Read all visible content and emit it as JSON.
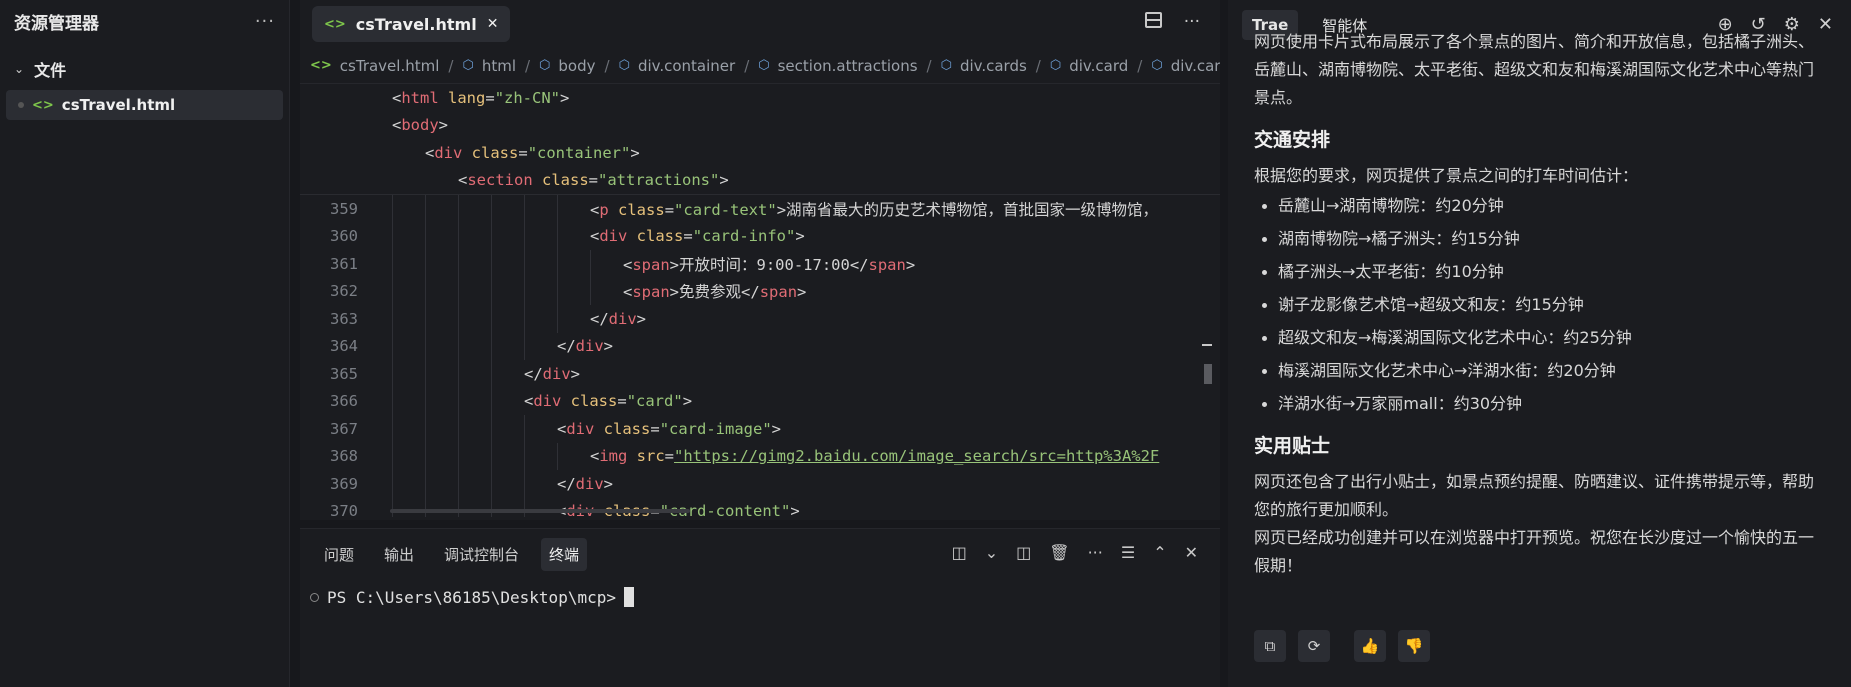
{
  "explorer": {
    "title": "资源管理器",
    "more_icon": "more-icon",
    "folder": "文件",
    "file": "csTravel.html"
  },
  "editor": {
    "tab_name": "csTravel.html",
    "breadcrumb": [
      "csTravel.html",
      "html",
      "body",
      "div.container",
      "section.attractions",
      "div.cards",
      "div.card",
      "div.card-co"
    ],
    "sticky": [
      {
        "indent": 0,
        "text": "<html lang=\"zh-CN\">"
      },
      {
        "indent": 0,
        "text": "<body>"
      },
      {
        "indent": 1,
        "text": "<div class=\"container\">"
      },
      {
        "indent": 2,
        "text": "<section class=\"attractions\">"
      }
    ],
    "lines": [
      {
        "num": "359",
        "text": "<p class=\"card-text\">湖南省最大的历史艺术博物馆，首批国家一级博物馆，"
      },
      {
        "num": "360",
        "text": "<div class=\"card-info\">"
      },
      {
        "num": "361",
        "text": "<span>开放时间：9:00-17:00</span>"
      },
      {
        "num": "362",
        "text": "<span>免费参观</span>"
      },
      {
        "num": "363",
        "text": "</div>"
      },
      {
        "num": "364",
        "text": "</div>"
      },
      {
        "num": "365",
        "text": "</div>"
      },
      {
        "num": "366",
        "text": "<div class=\"card\">"
      },
      {
        "num": "367",
        "text": "<div class=\"card-image\">"
      },
      {
        "num": "368",
        "text": "<img src=\"https://gimg2.baidu.com/image_search/src=http%3A%2F"
      },
      {
        "num": "369",
        "text": "</div>"
      },
      {
        "num": "370",
        "text": "<div class=\"card-content\">"
      }
    ]
  },
  "panel": {
    "tabs": [
      "问题",
      "输出",
      "调试控制台",
      "终端"
    ],
    "active_tab": "终端",
    "prompt": "PS C:\\Users\\86185\\Desktop\\mcp>"
  },
  "chat": {
    "tabs": [
      "Trae",
      "智能体"
    ],
    "intro": "网页使用卡片式布局展示了各个景点的图片、简介和开放信息，包括橘子洲头、岳麓山、湖南博物院、太平老街、超级文和友和梅溪湖国际文化艺术中心等热门景点。",
    "section1_title": "交通安排",
    "section1_intro": "根据您的要求，网页提供了景点之间的打车时间估计：",
    "routes": [
      "岳麓山→湖南博物院：约20分钟",
      "湖南博物院→橘子洲头：约15分钟",
      "橘子洲头→太平老街：约10分钟",
      "谢子龙影像艺术馆→超级文和友：约15分钟",
      "超级文和友→梅溪湖国际文化艺术中心：约25分钟",
      "梅溪湖国际文化艺术中心→洋湖水街：约20分钟",
      "洋湖水街→万家丽mall：约30分钟"
    ],
    "section2_title": "实用贴士",
    "section2_text": "网页还包含了出行小贴士，如景点预约提醒、防晒建议、证件携带提示等，帮助您的旅行更加顺利。",
    "closing": "网页已经成功创建并可以在浏览器中打开预览。祝您在长沙度过一个愉快的五一假期！"
  }
}
